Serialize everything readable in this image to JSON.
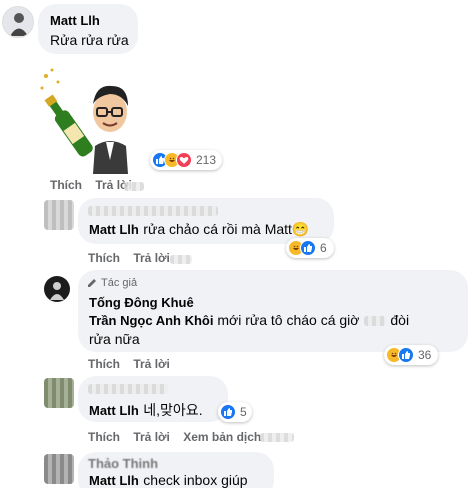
{
  "comments": [
    {
      "author": "Matt Llh",
      "text": "Rửa rửa rửa",
      "sticker": "champagne-avatar-sticker",
      "reactions": {
        "types": [
          "like",
          "haha",
          "love"
        ],
        "count": "213"
      },
      "actions": {
        "like": "Thích",
        "reply": "Trả lời"
      }
    },
    {
      "author": "Matt Llh",
      "text": "rửa chảo cá rồi mà Matt😁",
      "reactions": {
        "types": [
          "haha",
          "like"
        ],
        "count": "6"
      },
      "actions": {
        "like": "Thích",
        "reply": "Trả lời"
      }
    },
    {
      "badge": "Tác giả",
      "author": "Tống Đông Khuê",
      "mention": "Trần Ngọc Anh Khôi",
      "text_line1": " mới rửa tô cháo cá giờ",
      "text_line1_end": "đòi",
      "text_line2": "rửa nữa",
      "reactions": {
        "types": [
          "haha",
          "like"
        ],
        "count": "36"
      },
      "actions": {
        "like": "Thích",
        "reply": "Trả lời"
      }
    },
    {
      "author": "Matt Llh",
      "text": "네,맞아요.",
      "reactions": {
        "types": [
          "like"
        ],
        "count": "5"
      },
      "actions": {
        "like": "Thích",
        "reply": "Trả lời",
        "translate": "Xem bản dịch"
      }
    },
    {
      "author_partial": "Thảo Thinh",
      "author": "Matt Llh",
      "text": "check inbox giúp"
    }
  ],
  "colors": {
    "bubble": "#f0f2f5",
    "action_text": "#65676b",
    "like_blue": "#1877f2",
    "haha_yellow": "#f7b928",
    "love_red": "#f33e58"
  }
}
